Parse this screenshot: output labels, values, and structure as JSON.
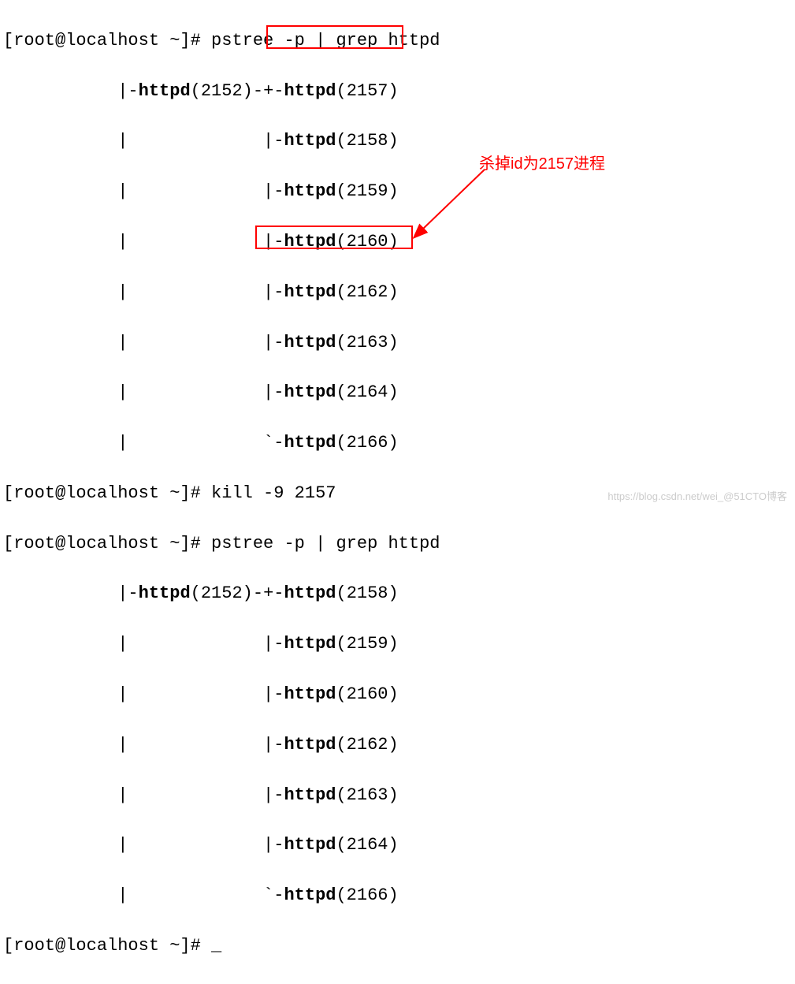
{
  "prompt": "[root@localhost ~]# ",
  "commands": {
    "pstree": "pstree -p | grep httpd",
    "kill": "kill -9 2157",
    "cursor": "_"
  },
  "tree1": {
    "l1a": "           |-",
    "l1b": "httpd",
    "l1c": "(2152)-+-",
    "l1d": "httpd",
    "l1e": "(2157)",
    "l2a": "           |             |-",
    "l2b": "httpd",
    "l2c": "(2158)",
    "l3a": "           |             |-",
    "l3b": "httpd",
    "l3c": "(2159)",
    "l4a": "           |             |-",
    "l4b": "httpd",
    "l4c": "(2160)",
    "l5a": "           |             |-",
    "l5b": "httpd",
    "l5c": "(2162)",
    "l6a": "           |             |-",
    "l6b": "httpd",
    "l6c": "(2163)",
    "l7a": "           |             |-",
    "l7b": "httpd",
    "l7c": "(2164)",
    "l8a": "           |             `-",
    "l8b": "httpd",
    "l8c": "(2166)"
  },
  "tree2": {
    "l1a": "           |-",
    "l1b": "httpd",
    "l1c": "(2152)-+-",
    "l1d": "httpd",
    "l1e": "(2158)",
    "l2a": "           |             |-",
    "l2b": "httpd",
    "l2c": "(2159)",
    "l3a": "           |             |-",
    "l3b": "httpd",
    "l3c": "(2160)",
    "l4a": "           |             |-",
    "l4b": "httpd",
    "l4c": "(2162)",
    "l5a": "           |             |-",
    "l5b": "httpd",
    "l5c": "(2163)",
    "l6a": "           |             |-",
    "l6b": "httpd",
    "l6c": "(2164)",
    "l7a": "           |             `-",
    "l7b": "httpd",
    "l7c": "(2166)"
  },
  "annotation": {
    "text": "杀掉id为2157进程"
  },
  "watermark": {
    "text": "https://blog.csdn.net/wei_@51CTO博客"
  }
}
